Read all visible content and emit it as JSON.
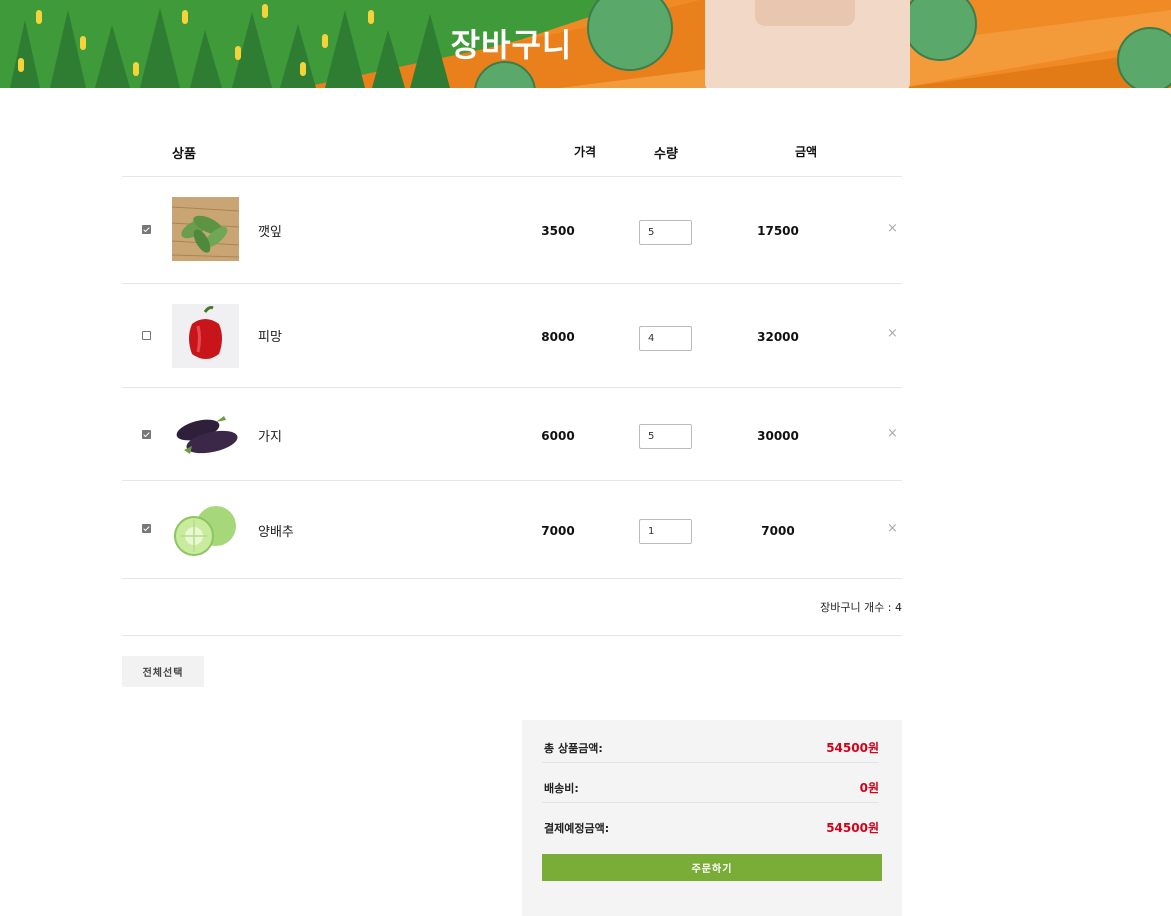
{
  "banner": {
    "title": "장바구니"
  },
  "table": {
    "headers": {
      "product": "상품",
      "price": "가격",
      "qty": "수량",
      "amount": "금액"
    },
    "rows": [
      {
        "checked": true,
        "name": "깻잎",
        "image": "perilla-leaves",
        "price": "3500",
        "qty": "5",
        "amount": "17500",
        "remove": "×"
      },
      {
        "checked": false,
        "name": "피망",
        "image": "red-pepper",
        "price": "8000",
        "qty": "4",
        "amount": "32000",
        "remove": "×"
      },
      {
        "checked": true,
        "name": "가지",
        "image": "eggplant",
        "price": "6000",
        "qty": "5",
        "amount": "30000",
        "remove": "×"
      },
      {
        "checked": true,
        "name": "양배추",
        "image": "cabbage",
        "price": "7000",
        "qty": "1",
        "amount": "7000",
        "remove": "×"
      }
    ],
    "count_text": "장바구니 개수 : 4"
  },
  "select_all_label": "전체선택",
  "summary": {
    "subtotal_label": "총 상품금액:",
    "subtotal_value": "54500원",
    "shipping_label": "배송비:",
    "shipping_value": "0원",
    "total_label": "결제예정금액:",
    "total_value": "54500원",
    "order_label": "주문하기"
  },
  "colors": {
    "accent": "#7aad38",
    "price_red": "#d0021b",
    "banner_orange": "#f28c28",
    "banner_green": "#4caf50"
  }
}
